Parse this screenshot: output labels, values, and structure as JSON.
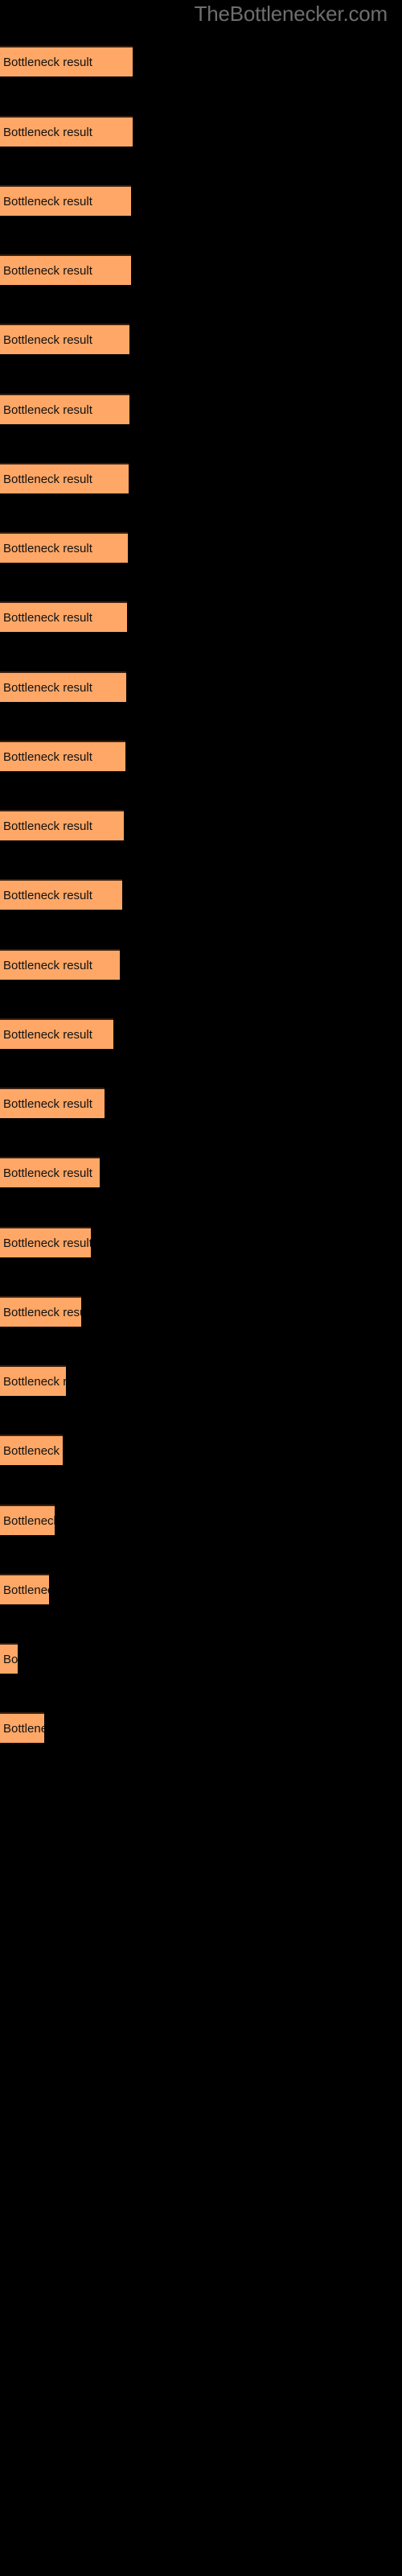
{
  "watermark": "TheBottlenecker.com",
  "theme": {
    "background": "#000000",
    "bar_fill": "#ffa766",
    "bar_border": "#3a1f0f",
    "label_color": "#111111",
    "watermark_color": "#6e6e6e"
  },
  "chart_data": {
    "type": "bar",
    "orientation": "horizontal",
    "title": "",
    "subtitle": "",
    "xlabel": "",
    "ylabel": "",
    "grid": false,
    "legend": false,
    "bar_label_text": "Bottleneck result",
    "categories": [
      "Bottleneck result",
      "Bottleneck result",
      "Bottleneck result",
      "Bottleneck result",
      "Bottleneck result",
      "Bottleneck result",
      "Bottleneck result",
      "Bottleneck result",
      "Bottleneck result",
      "Bottleneck result",
      "Bottleneck result",
      "Bottleneck result",
      "Bottleneck result",
      "Bottleneck result",
      "Bottleneck result",
      "Bottleneck result",
      "Bottleneck result",
      "Bottleneck result",
      "Bottleneck result",
      "Bottleneck result",
      "Bottleneck result",
      "Bottleneck result",
      "Bottleneck result"
    ],
    "values": [
      165,
      165,
      163,
      163,
      161,
      161,
      160,
      159,
      158,
      157,
      156,
      154,
      152,
      149,
      141,
      130,
      124,
      113,
      101,
      82,
      78,
      68,
      61
    ],
    "xlim": [
      0,
      500
    ],
    "bars": [
      {
        "index": 1,
        "top": 57,
        "width": 165,
        "label": "Bottleneck result"
      },
      {
        "index": 2,
        "top": 144,
        "width": 165,
        "label": "Bottleneck result"
      },
      {
        "index": 3,
        "top": 230,
        "width": 163,
        "label": "Bottleneck result"
      },
      {
        "index": 4,
        "top": 316,
        "width": 163,
        "label": "Bottleneck result"
      },
      {
        "index": 5,
        "top": 402,
        "width": 161,
        "label": "Bottleneck result"
      },
      {
        "index": 6,
        "top": 489,
        "width": 161,
        "label": "Bottleneck result"
      },
      {
        "index": 7,
        "top": 575,
        "width": 160,
        "label": "Bottleneck result"
      },
      {
        "index": 8,
        "top": 661,
        "width": 159,
        "label": "Bottleneck result"
      },
      {
        "index": 9,
        "top": 747,
        "width": 158,
        "label": "Bottleneck result"
      },
      {
        "index": 10,
        "top": 834,
        "width": 157,
        "label": "Bottleneck result"
      },
      {
        "index": 11,
        "top": 920,
        "width": 156,
        "label": "Bottleneck result"
      },
      {
        "index": 12,
        "top": 1006,
        "width": 154,
        "label": "Bottleneck result"
      },
      {
        "index": 13,
        "top": 1092,
        "width": 152,
        "label": "Bottleneck result"
      },
      {
        "index": 14,
        "top": 1179,
        "width": 149,
        "label": "Bottleneck result"
      },
      {
        "index": 15,
        "top": 1265,
        "width": 141,
        "label": "Bottleneck result"
      },
      {
        "index": 16,
        "top": 1351,
        "width": 130,
        "label": "Bottleneck result"
      },
      {
        "index": 17,
        "top": 1437,
        "width": 124,
        "label": "Bottleneck result"
      },
      {
        "index": 18,
        "top": 1524,
        "width": 113,
        "label": "Bottleneck result"
      },
      {
        "index": 19,
        "top": 1610,
        "width": 101,
        "label": "Bottleneck result"
      },
      {
        "index": 20,
        "top": 1696,
        "width": 82,
        "label": "Bottleneck result"
      },
      {
        "index": 21,
        "top": 1782,
        "width": 78,
        "label": "Bottleneck result"
      },
      {
        "index": 22,
        "top": 1869,
        "width": 68,
        "label": "Bottleneck result"
      },
      {
        "index": 23,
        "top": 1955,
        "width": 61,
        "label": "Bottleneck result"
      },
      {
        "index": 24,
        "top": 2041,
        "width": 22,
        "label": "Bottleneck result"
      },
      {
        "index": 25,
        "top": 2127,
        "width": 55,
        "label": "Bottleneck result"
      }
    ]
  }
}
